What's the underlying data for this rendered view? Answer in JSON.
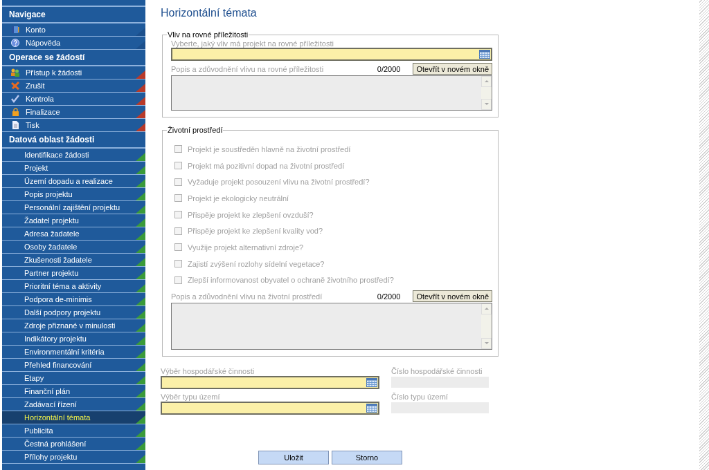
{
  "sidebar": {
    "sections": [
      {
        "title": "Navigace",
        "items": [
          {
            "label": "Konto",
            "color": "#1b4f8c",
            "selected": false
          },
          {
            "label": "Nápověda",
            "color": "#1b4f8c",
            "selected": false
          }
        ]
      },
      {
        "title": "Operace se žádostí",
        "items": [
          {
            "label": "Přístup k žádosti",
            "color": "#b83a2a",
            "selected": false
          },
          {
            "label": "Zrušit",
            "color": "#b83a2a",
            "selected": false
          },
          {
            "label": "Kontrola",
            "color": "#b83a2a",
            "selected": false
          },
          {
            "label": "Finalizace",
            "color": "#b83a2a",
            "selected": false
          },
          {
            "label": "Tisk",
            "color": "#b83a2a",
            "selected": false
          }
        ]
      },
      {
        "title": "Datová oblast žádosti",
        "items": [
          {
            "label": "Identifikace žádosti",
            "color": "#3a9a3a",
            "selected": false
          },
          {
            "label": "Projekt",
            "color": "#3a9a3a",
            "selected": false
          },
          {
            "label": "Území dopadu a realizace",
            "color": "#3a9a3a",
            "selected": false
          },
          {
            "label": "Popis projektu",
            "color": "#3a9a3a",
            "selected": false
          },
          {
            "label": "Personální zajištění projektu",
            "color": "#3a9a3a",
            "selected": false
          },
          {
            "label": "Žadatel projektu",
            "color": "#3a9a3a",
            "selected": false
          },
          {
            "label": "Adresa žadatele",
            "color": "#3a9a3a",
            "selected": false
          },
          {
            "label": "Osoby žadatele",
            "color": "#3a9a3a",
            "selected": false
          },
          {
            "label": "Zkušenosti žadatele",
            "color": "#3a9a3a",
            "selected": false
          },
          {
            "label": "Partner projektu",
            "color": "#3a9a3a",
            "selected": false
          },
          {
            "label": "Prioritní téma a aktivity",
            "color": "#3a9a3a",
            "selected": false
          },
          {
            "label": "Podpora de-minimis",
            "color": "#3a9a3a",
            "selected": false
          },
          {
            "label": "Další podpory projektu",
            "color": "#3a9a3a",
            "selected": false
          },
          {
            "label": "Zdroje přiznané v minulosti",
            "color": "#3a9a3a",
            "selected": false
          },
          {
            "label": "Indikátory projektu",
            "color": "#3a9a3a",
            "selected": false
          },
          {
            "label": "Environmentální kritéria",
            "color": "#3a9a3a",
            "selected": false
          },
          {
            "label": "Přehled financování",
            "color": "#3a9a3a",
            "selected": false
          },
          {
            "label": "Etapy",
            "color": "#3a9a3a",
            "selected": false
          },
          {
            "label": "Finanční plán",
            "color": "#3a9a3a",
            "selected": false
          },
          {
            "label": "Zadávací řízení",
            "color": "#3a9a3a",
            "selected": false
          },
          {
            "label": "Horizontální témata",
            "color": "#3a9a3a",
            "selected": true
          },
          {
            "label": "Publicita",
            "color": "#3a9a3a",
            "selected": false
          },
          {
            "label": "Čestná prohlášení",
            "color": "#3a9a3a",
            "selected": false
          },
          {
            "label": "Přílohy projektu",
            "color": "#3a9a3a",
            "selected": false
          }
        ]
      }
    ]
  },
  "page": {
    "title": "Horizontální témata"
  },
  "equal_opportunities": {
    "legend": "Vliv na rovné příležitosti",
    "select_label": "Vyberte, jaký vliv má projekt na rovné příležitosti",
    "description_label": "Popis a zdůvodnění vlivu na rovné příležitosti",
    "counter": "0/2000",
    "open_button": "Otevřít v novém okně"
  },
  "environment": {
    "legend": "Životní prostředí",
    "checkboxes": [
      {
        "label": "Projekt je soustředěn hlavně na životní prostředí",
        "checked": false,
        "disabled": true
      },
      {
        "label": "Projekt má pozitivní dopad na životní prostředí",
        "checked": false,
        "disabled": true
      },
      {
        "label": "Vyžaduje projekt posouzení vlivu na životní prostředí?",
        "checked": false,
        "disabled": true
      },
      {
        "label": "Projekt je ekologicky neutrální",
        "checked": false,
        "disabled": true
      },
      {
        "label": "Přispěje projekt ke zlepšení ovzduší?",
        "checked": false,
        "disabled": true
      },
      {
        "label": "Přispěje projekt ke zlepšení kvality vod?",
        "checked": false,
        "disabled": true
      },
      {
        "label": "Využije projekt alternativní zdroje?",
        "checked": false,
        "disabled": true
      },
      {
        "label": "Zajistí zvýšení rozlohy sídelní vegetace?",
        "checked": false,
        "disabled": true
      },
      {
        "label": "Zlepší informovanost obyvatel o ochraně životního prostředí?",
        "checked": false,
        "disabled": true
      }
    ],
    "description_label": "Popis a zdůvodnění vlivu na životní prostředí",
    "counter": "0/2000",
    "open_button": "Otevřít v novém okně"
  },
  "selects": [
    {
      "label": "Výběr hospodářské činnosti",
      "number_label": "Číslo hospodářské činnosti"
    },
    {
      "label": "Výběr typu území",
      "number_label": "Číslo typu území"
    }
  ],
  "buttons": [
    "Uložit",
    "Storno"
  ]
}
